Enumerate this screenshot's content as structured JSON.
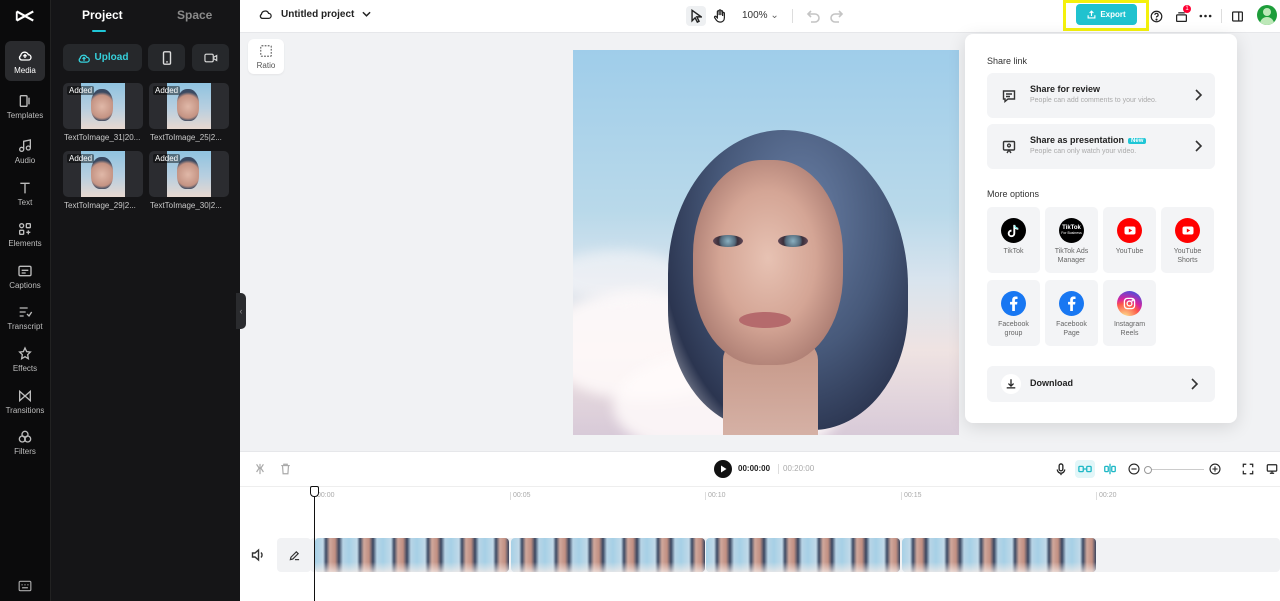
{
  "rail": {
    "items": [
      {
        "label": "Media",
        "icon": "media-cloud-icon",
        "active": true
      },
      {
        "label": "Templates",
        "icon": "templates-icon"
      },
      {
        "label": "Audio",
        "icon": "audio-note-icon"
      },
      {
        "label": "Text",
        "icon": "text-t-icon"
      },
      {
        "label": "Elements",
        "icon": "elements-grid-icon"
      },
      {
        "label": "Captions",
        "icon": "captions-icon"
      },
      {
        "label": "Transcript",
        "icon": "transcript-icon"
      },
      {
        "label": "Effects",
        "icon": "effects-star-icon"
      },
      {
        "label": "Transitions",
        "icon": "transitions-bowtie-icon"
      },
      {
        "label": "Filters",
        "icon": "filters-circles-icon"
      }
    ]
  },
  "panel": {
    "tabs": [
      "Project",
      "Space"
    ],
    "upload_label": "Upload",
    "media": [
      {
        "badge": "Added",
        "label": "TextToImage_31|20..."
      },
      {
        "badge": "Added",
        "label": "TextToImage_25|2..."
      },
      {
        "badge": "Added",
        "label": "TextToImage_29|2..."
      },
      {
        "badge": "Added",
        "label": "TextToImage_30|2..."
      }
    ]
  },
  "topbar": {
    "project_title": "Untitled project",
    "zoom": "100%",
    "export_label": "Export",
    "notification_count": "1"
  },
  "canvas": {
    "ratio_label": "Ratio"
  },
  "share": {
    "share_link_heading": "Share link",
    "review_title": "Share for review",
    "review_sub": "People can add comments to your video.",
    "presentation_title": "Share as presentation",
    "presentation_tag": "New",
    "presentation_sub": "People can only watch your video.",
    "more_options_heading": "More options",
    "options": [
      {
        "label": "TikTok",
        "icon": "tiktok-icon",
        "color": "#000000"
      },
      {
        "label": "TikTok Ads Manager",
        "icon": "tiktok-ads-icon",
        "color": "#000000",
        "logo_text": "TikTok",
        "logo_sub": "For Business"
      },
      {
        "label": "YouTube",
        "icon": "youtube-icon",
        "color": "#ff0000"
      },
      {
        "label": "YouTube Shorts",
        "icon": "youtube-shorts-icon",
        "color": "#ff0000"
      },
      {
        "label": "Facebook group",
        "icon": "facebook-icon",
        "color": "#1877f2"
      },
      {
        "label": "Facebook Page",
        "icon": "facebook-icon",
        "color": "#1877f2"
      },
      {
        "label": "Instagram Reels",
        "icon": "instagram-icon",
        "color": "#d6249f"
      }
    ],
    "download_label": "Download"
  },
  "timeline": {
    "current_time": "00:00:00",
    "duration": "00:20:00",
    "ticks": [
      "00:00",
      "00:05",
      "00:10",
      "00:15",
      "00:20"
    ]
  },
  "colors": {
    "accent": "#20c2cf",
    "rail_bg": "#0b0b0c",
    "panel_bg": "#151517",
    "highlight": "#f4f10c"
  }
}
